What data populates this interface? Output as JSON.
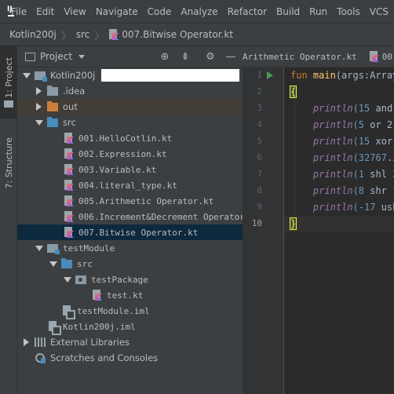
{
  "menubar": {
    "logo_text": "IJ",
    "items": [
      "File",
      "Edit",
      "View",
      "Navigate",
      "Code",
      "Analyze",
      "Refactor",
      "Build",
      "Run",
      "Tools",
      "VCS"
    ]
  },
  "breadcrumb": {
    "items": [
      "Kotlin200j",
      "src",
      "007.Bitwise Operator.kt"
    ]
  },
  "side_tabs": {
    "project": "1: Project",
    "structure": "7: Structure"
  },
  "project_panel": {
    "title": "Project",
    "editor_tabs": [
      "Arithmetic Operator.kt",
      "00"
    ]
  },
  "tree": [
    {
      "label": "Kotlin200j",
      "level": 0,
      "expanded": true,
      "icon": "module-folder"
    },
    {
      "label": ".idea",
      "level": 1,
      "expanded": false,
      "icon": "folder"
    },
    {
      "label": "out",
      "level": 1,
      "expanded": false,
      "icon": "folder-orange"
    },
    {
      "label": "src",
      "level": 1,
      "expanded": true,
      "icon": "folder-blue"
    },
    {
      "label": "001.HelloCotlin.kt",
      "level": 2,
      "icon": "kotlin-file"
    },
    {
      "label": "002.Expression.kt",
      "level": 2,
      "icon": "kotlin-file"
    },
    {
      "label": "003.Variable.kt",
      "level": 2,
      "icon": "kotlin-file"
    },
    {
      "label": "004.literal_type.kt",
      "level": 2,
      "icon": "kotlin-file"
    },
    {
      "label": "005.Arithmetic Operator.kt",
      "level": 2,
      "icon": "kotlin-file"
    },
    {
      "label": "006.Increment&Decrement Operator.kt",
      "level": 2,
      "icon": "kotlin-file"
    },
    {
      "label": "007.Bitwise Operator.kt",
      "level": 2,
      "icon": "kotlin-file",
      "selected": true
    },
    {
      "label": "testModule",
      "level": 1,
      "expanded": true,
      "icon": "module-folder"
    },
    {
      "label": "src",
      "level": 2,
      "expanded": true,
      "icon": "folder-blue"
    },
    {
      "label": "testPackage",
      "level": 3,
      "expanded": true,
      "icon": "package"
    },
    {
      "label": "test.kt",
      "level": 4,
      "icon": "kotlin-file"
    },
    {
      "label": "testModule.iml",
      "level": 2,
      "icon": "iml-file"
    },
    {
      "label": "Kotlin200j.iml",
      "level": 1,
      "icon": "iml-file"
    },
    {
      "label": "External Libraries",
      "level": 0,
      "expanded": false,
      "icon": "libraries"
    },
    {
      "label": "Scratches and Consoles",
      "level": 0,
      "icon": "scratches"
    }
  ],
  "editor": {
    "line_numbers": [
      "1",
      "2",
      "3",
      "4",
      "5",
      "6",
      "7",
      "8",
      "9",
      "10"
    ],
    "current_line": "10",
    "lines": {
      "l1_kw": "fun ",
      "l1_name": "main",
      "l1_rest": "(args:Array",
      "l2": "{",
      "l3_fn": "println",
      "l3_num": "(15",
      "l3_rest": " and ",
      "l4_fn": "println",
      "l4_num": "(5",
      "l4_rest": " or 2)",
      "l5_fn": "println",
      "l5_num": "(15",
      "l5_rest": " xor ",
      "l6_num": "(32767",
      "l6_rest": ".i",
      "l7_fn": "println",
      "l7_num": "(1",
      "l7_rest": " shl 3",
      "l8_fn": "println",
      "l8_num": "(8",
      "l8_rest": " shr 1",
      "l9_fn": "println",
      "l9_num": "(-17",
      "l9_rest": " ush",
      "l10": "}"
    }
  },
  "colors": {
    "background": "#2b2b2b",
    "panel": "#3c3f41",
    "selection": "#0d293e",
    "keyword": "#cc7832",
    "function_decl": "#ffc66d",
    "call": "#9876aa",
    "number": "#6897bb"
  }
}
